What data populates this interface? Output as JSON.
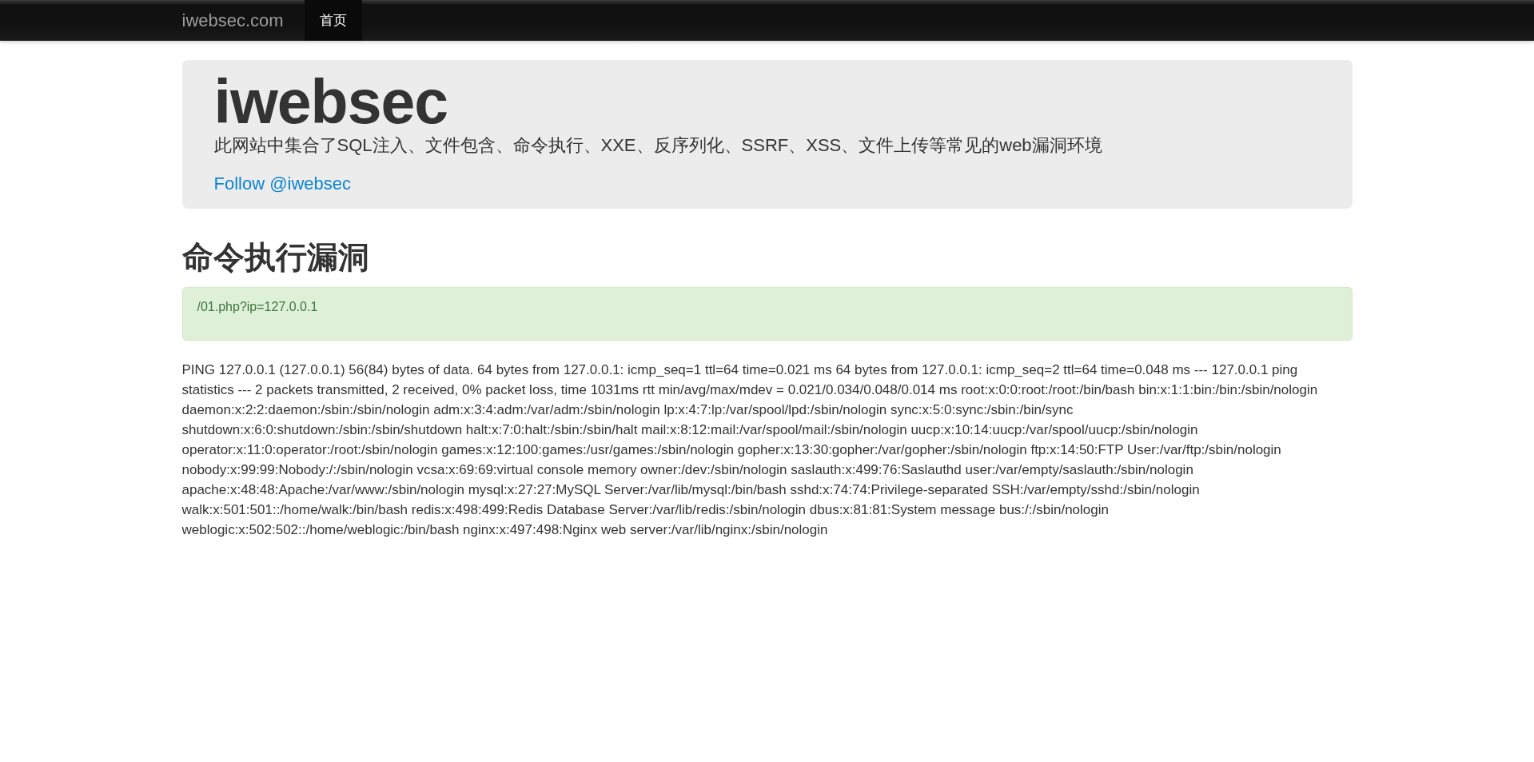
{
  "navbar": {
    "brand": "iwebsec.com",
    "items": [
      {
        "label": "首页",
        "selected": true
      }
    ]
  },
  "jumbotron": {
    "title": "iwebsec",
    "description": "此网站中集合了SQL注入、文件包含、命令执行、XXE、反序列化、SSRF、XSS、文件上传等常见的web漏洞环境",
    "link": "Follow @iwebsec"
  },
  "section": {
    "heading": "命令执行漏洞",
    "alert": "/01.php?ip=127.0.0.1",
    "output": "PING 127.0.0.1 (127.0.0.1) 56(84) bytes of data. 64 bytes from 127.0.0.1: icmp_seq=1 ttl=64 time=0.021 ms 64 bytes from 127.0.0.1: icmp_seq=2 ttl=64 time=0.048 ms --- 127.0.0.1 ping statistics --- 2 packets transmitted, 2 received, 0% packet loss, time 1031ms rtt min/avg/max/mdev = 0.021/0.034/0.048/0.014 ms root:x:0:0:root:/root:/bin/bash bin:x:1:1:bin:/bin:/sbin/nologin daemon:x:2:2:daemon:/sbin:/sbin/nologin adm:x:3:4:adm:/var/adm:/sbin/nologin lp:x:4:7:lp:/var/spool/lpd:/sbin/nologin sync:x:5:0:sync:/sbin:/bin/sync shutdown:x:6:0:shutdown:/sbin:/sbin/shutdown halt:x:7:0:halt:/sbin:/sbin/halt mail:x:8:12:mail:/var/spool/mail:/sbin/nologin uucp:x:10:14:uucp:/var/spool/uucp:/sbin/nologin operator:x:11:0:operator:/root:/sbin/nologin games:x:12:100:games:/usr/games:/sbin/nologin gopher:x:13:30:gopher:/var/gopher:/sbin/nologin ftp:x:14:50:FTP User:/var/ftp:/sbin/nologin nobody:x:99:99:Nobody:/:/sbin/nologin vcsa:x:69:69:virtual console memory owner:/dev:/sbin/nologin saslauth:x:499:76:Saslauthd user:/var/empty/saslauth:/sbin/nologin apache:x:48:48:Apache:/var/www:/sbin/nologin mysql:x:27:27:MySQL Server:/var/lib/mysql:/bin/bash sshd:x:74:74:Privilege-separated SSH:/var/empty/sshd:/sbin/nologin walk:x:501:501::/home/walk:/bin/bash redis:x:498:499:Redis Database Server:/var/lib/redis:/sbin/nologin dbus:x:81:81:System message bus:/:/sbin/nologin weblogic:x:502:502::/home/weblogic:/bin/bash nginx:x:497:498:Nginx web server:/var/lib/nginx:/sbin/nologin"
  }
}
